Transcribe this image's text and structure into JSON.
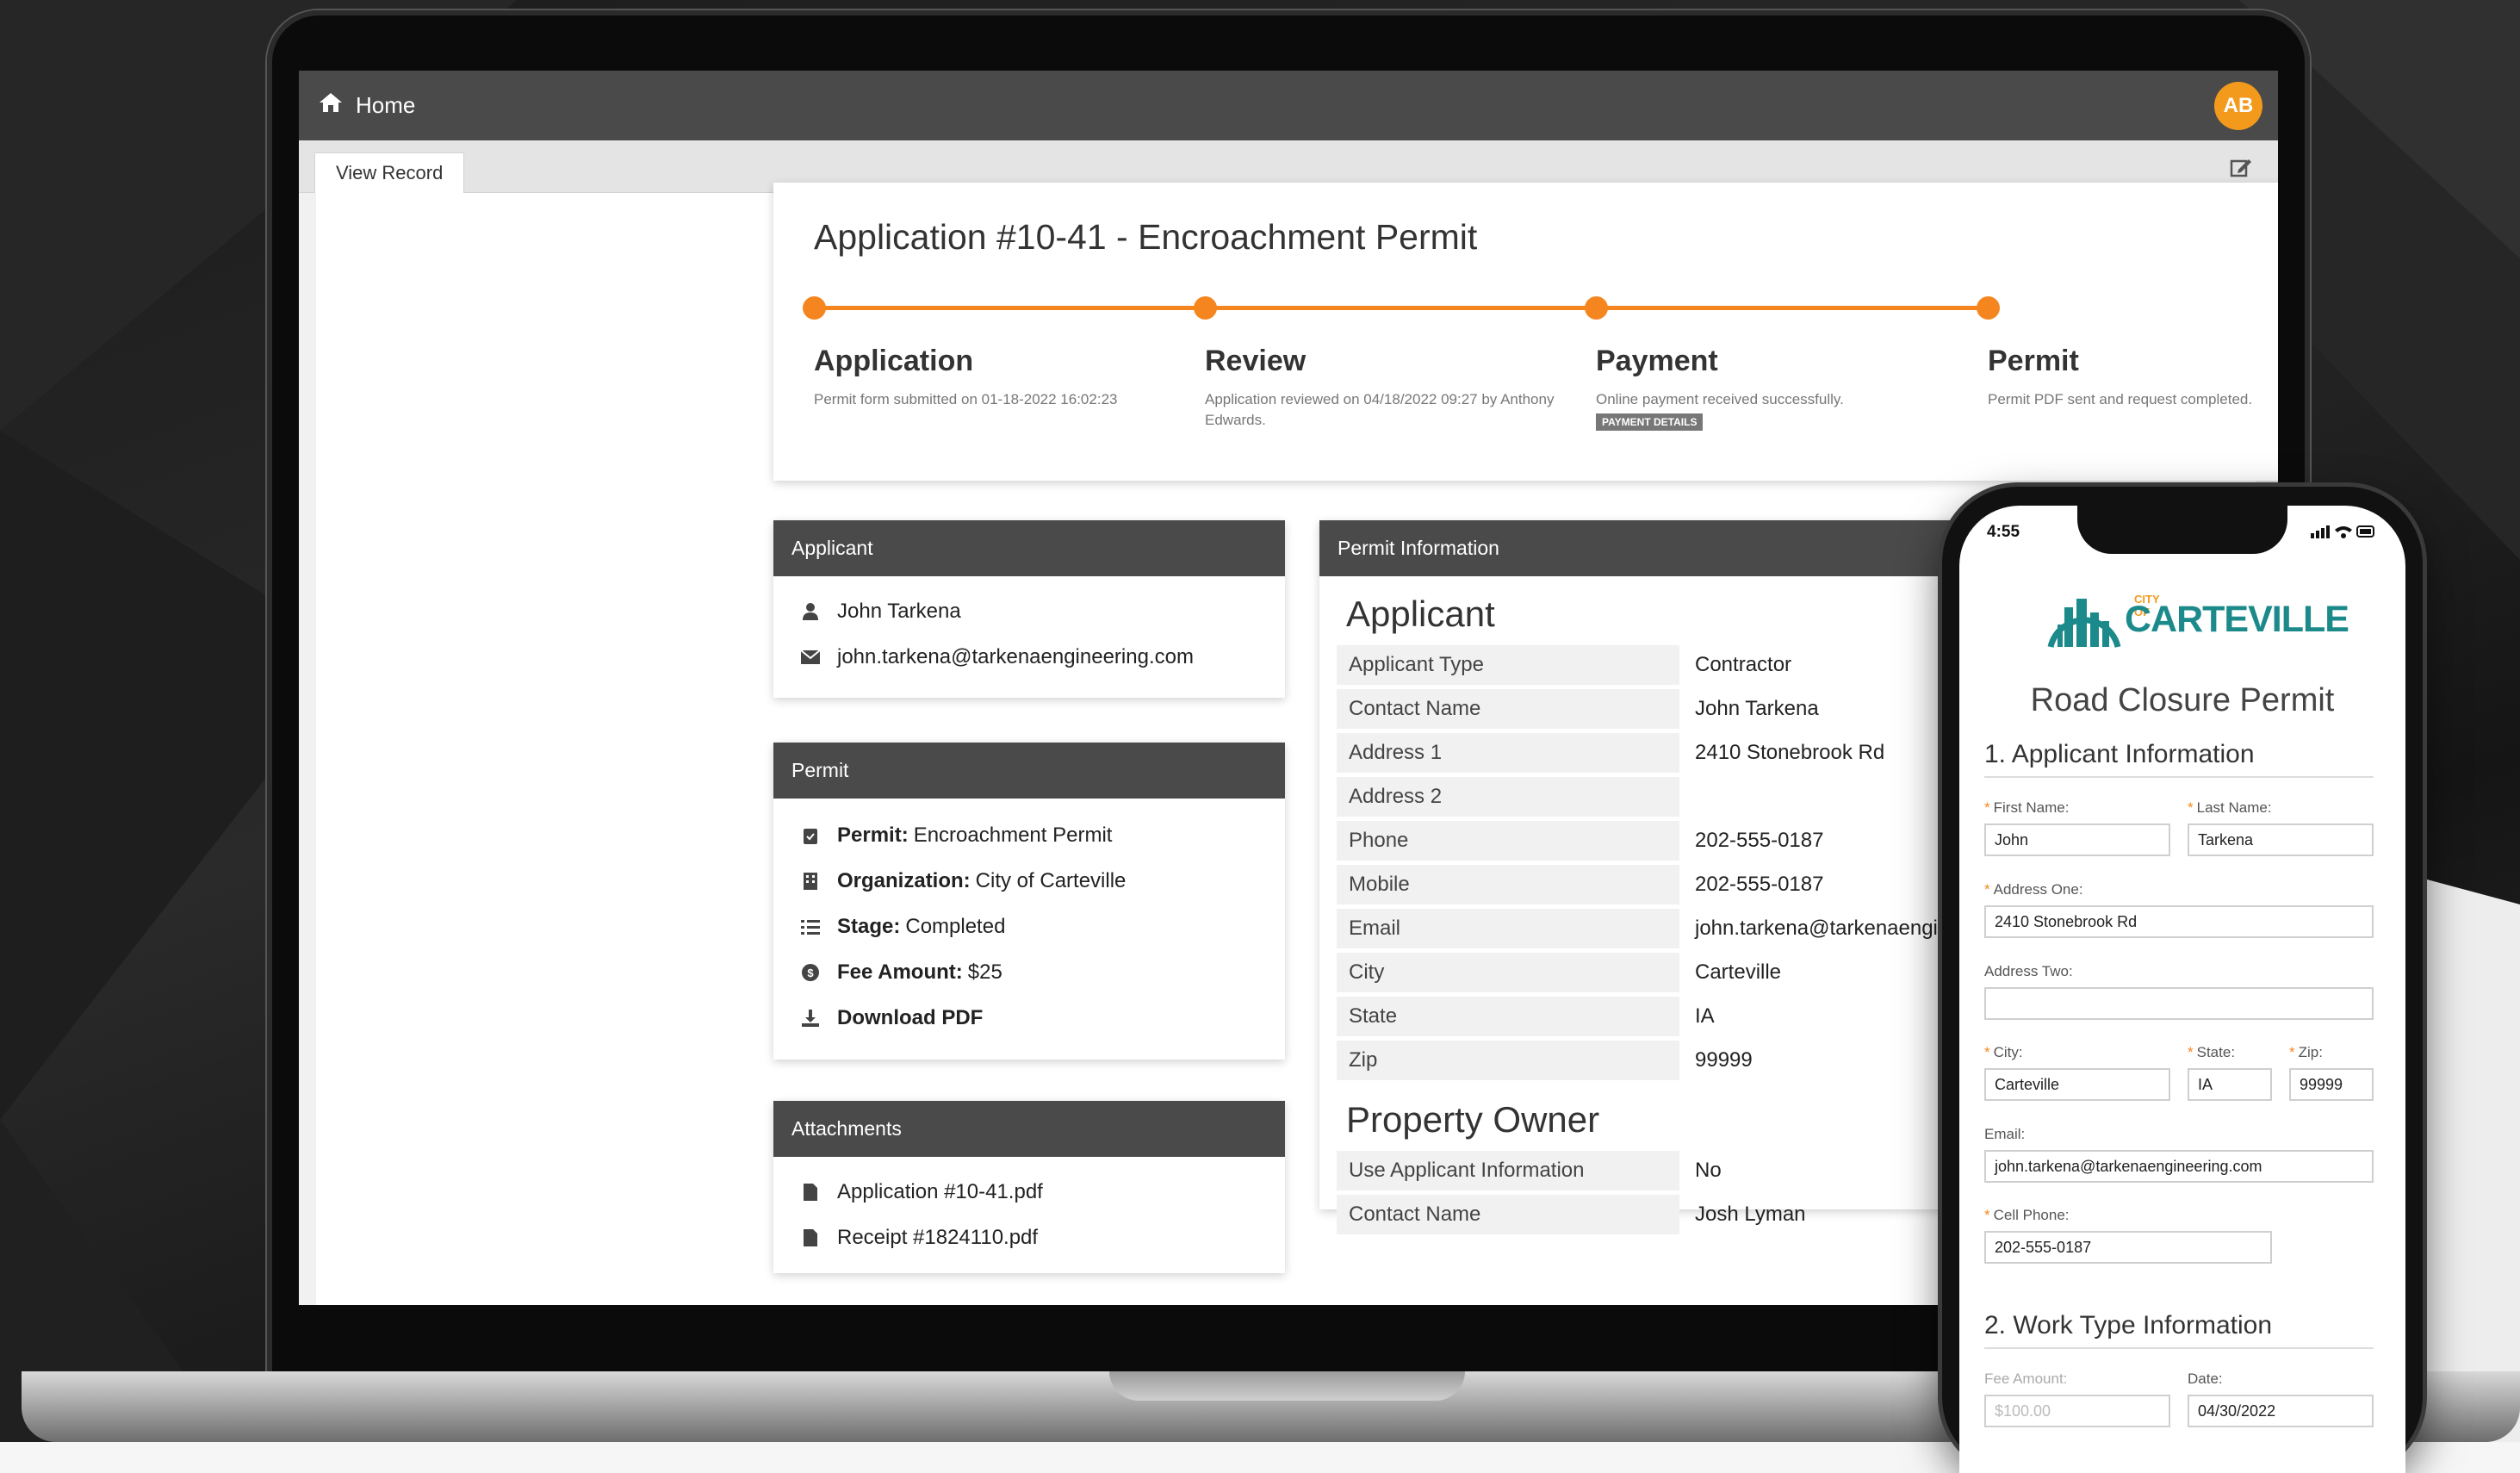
{
  "header": {
    "home_label": "Home",
    "avatar_initials": "AB"
  },
  "tabs": {
    "view_record": "View Record"
  },
  "application": {
    "title": "Application #10-41 - Encroachment Permit",
    "stages": [
      {
        "name": "Application",
        "desc": "Permit form submitted on 01-18-2022 16:02:23"
      },
      {
        "name": "Review",
        "desc": "Application reviewed on 04/18/2022 09:27 by Anthony Edwards."
      },
      {
        "name": "Payment",
        "desc": "Online payment received successfully.",
        "badge": "PAYMENT DETAILS"
      },
      {
        "name": "Permit",
        "desc": "Permit PDF sent and request completed."
      }
    ]
  },
  "applicant_panel": {
    "title": "Applicant",
    "name": "John Tarkena",
    "email": "john.tarkena@tarkenaengineering.com"
  },
  "permit_panel": {
    "title": "Permit",
    "permit_label": "Permit:",
    "permit_value": "Encroachment Permit",
    "org_label": "Organization:",
    "org_value": "City of Carteville",
    "stage_label": "Stage:",
    "stage_value": "Completed",
    "fee_label": "Fee Amount:",
    "fee_value": "$25",
    "download_label": "Download PDF"
  },
  "attachments_panel": {
    "title": "Attachments",
    "files": [
      "Application #10-41.pdf",
      "Receipt #1824110.pdf"
    ]
  },
  "permit_info": {
    "title": "Permit Information",
    "applicant_heading": "Applicant",
    "applicant_rows": [
      {
        "key": "Applicant Type",
        "value": "Contractor"
      },
      {
        "key": "Contact Name",
        "value": "John Tarkena"
      },
      {
        "key": "Address 1",
        "value": "2410 Stonebrook Rd"
      },
      {
        "key": "Address 2",
        "value": ""
      },
      {
        "key": "Phone",
        "value": "202-555-0187"
      },
      {
        "key": "Mobile",
        "value": "202-555-0187"
      },
      {
        "key": "Email",
        "value": "john.tarkena@tarkenaengineering.com"
      },
      {
        "key": "City",
        "value": "Carteville"
      },
      {
        "key": "State",
        "value": "IA"
      },
      {
        "key": "Zip",
        "value": "99999"
      }
    ],
    "owner_heading": "Property Owner",
    "owner_rows": [
      {
        "key": "Use Applicant Information",
        "value": "No"
      },
      {
        "key": "Contact Name",
        "value": "Josh Lyman"
      }
    ]
  },
  "phone": {
    "time": "4:55",
    "logo_city": "CITY OF",
    "logo_name": "CARTEVILLE",
    "form_title": "Road Closure Permit",
    "section1": "1. Applicant Information",
    "fields": {
      "first_name": {
        "label": "First Name:",
        "value": "John"
      },
      "last_name": {
        "label": "Last Name:",
        "value": "Tarkena"
      },
      "address_one": {
        "label": "Address One:",
        "value": "2410 Stonebrook Rd"
      },
      "address_two": {
        "label": "Address Two:",
        "value": ""
      },
      "city": {
        "label": "City:",
        "value": "Carteville"
      },
      "state": {
        "label": "State:",
        "value": "IA"
      },
      "zip": {
        "label": "Zip:",
        "value": "99999"
      },
      "email": {
        "label": "Email:",
        "value": "john.tarkena@tarkenaengineering.com"
      },
      "cell": {
        "label": "Cell Phone:",
        "value": "202-555-0187"
      },
      "fee": {
        "label": "Fee Amount:",
        "value": "$100.00"
      },
      "date": {
        "label": "Date:",
        "value": "04/30/2022"
      }
    },
    "section2": "2. Work Type Information"
  },
  "colors": {
    "accent": "#f5861f",
    "header": "#4a4a4a",
    "brand_teal": "#1c8a8b",
    "avatar": "#f39a1c"
  }
}
